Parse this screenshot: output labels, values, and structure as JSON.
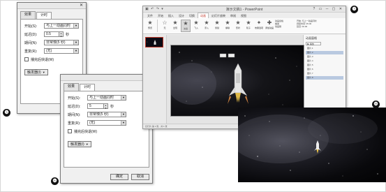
{
  "badges": [
    "❺",
    "❻",
    "❼",
    "❽"
  ],
  "dialog_a": {
    "tabs": [
      "效果",
      "计时"
    ],
    "rows": [
      {
        "label": "开始(S):",
        "value": "与上一动画同时"
      },
      {
        "label": "延迟(D):",
        "value": "0.5",
        "unit": "秒"
      },
      {
        "label": "期间(N):",
        "value": "非常慢(5 秒)"
      },
      {
        "label": "重复(R):",
        "value": "(无)"
      }
    ],
    "rewind_label": "播完后快退(W)",
    "trigger_label": "触发器(I)"
  },
  "dialog_b": {
    "tabs": [
      "效果",
      "计时"
    ],
    "rows": [
      {
        "label": "开始(S):",
        "value": "与上一动画同时"
      },
      {
        "label": "延迟(D):",
        "value": "5",
        "unit": "秒"
      },
      {
        "label": "期间(N):",
        "value": "非常慢(5 秒)"
      },
      {
        "label": "重复(R):",
        "value": "(无)"
      }
    ],
    "rewind_label": "播完后快退(W)",
    "trigger_label": "触发器(I)",
    "ok_label": "确定",
    "cancel_label": "取消"
  },
  "ppt": {
    "title": "演示文稿1 - PowerPoint",
    "ribbon_tabs": [
      "文件",
      "开始",
      "插入",
      "设计",
      "切换",
      "动画",
      "幻灯片放映",
      "审阅",
      "视图"
    ],
    "active_tab": "动画",
    "ribbon_buttons": [
      "预览",
      "无",
      "出现",
      "淡出",
      "飞入",
      "浮入",
      "劈裂",
      "擦除",
      "形状",
      "轮子",
      "效果选项",
      "添加动画"
    ],
    "ribbon_extra": [
      "动画窗格",
      "触发",
      "动画刷"
    ],
    "timing": [
      "开始: 与上一动画同时",
      "持续时间: 05.00",
      "延迟: 00.00"
    ],
    "slide_number": "1",
    "pane_title": "动画窗格",
    "pane_play": "▶ 播放",
    "pane_items": [
      "图片 1",
      "图片 2",
      "图片 3",
      "图片 4",
      "图片 5",
      "图片 6",
      "图片 7",
      "图片 8"
    ],
    "status": "幻灯片 第 1 张，共 1 张"
  }
}
